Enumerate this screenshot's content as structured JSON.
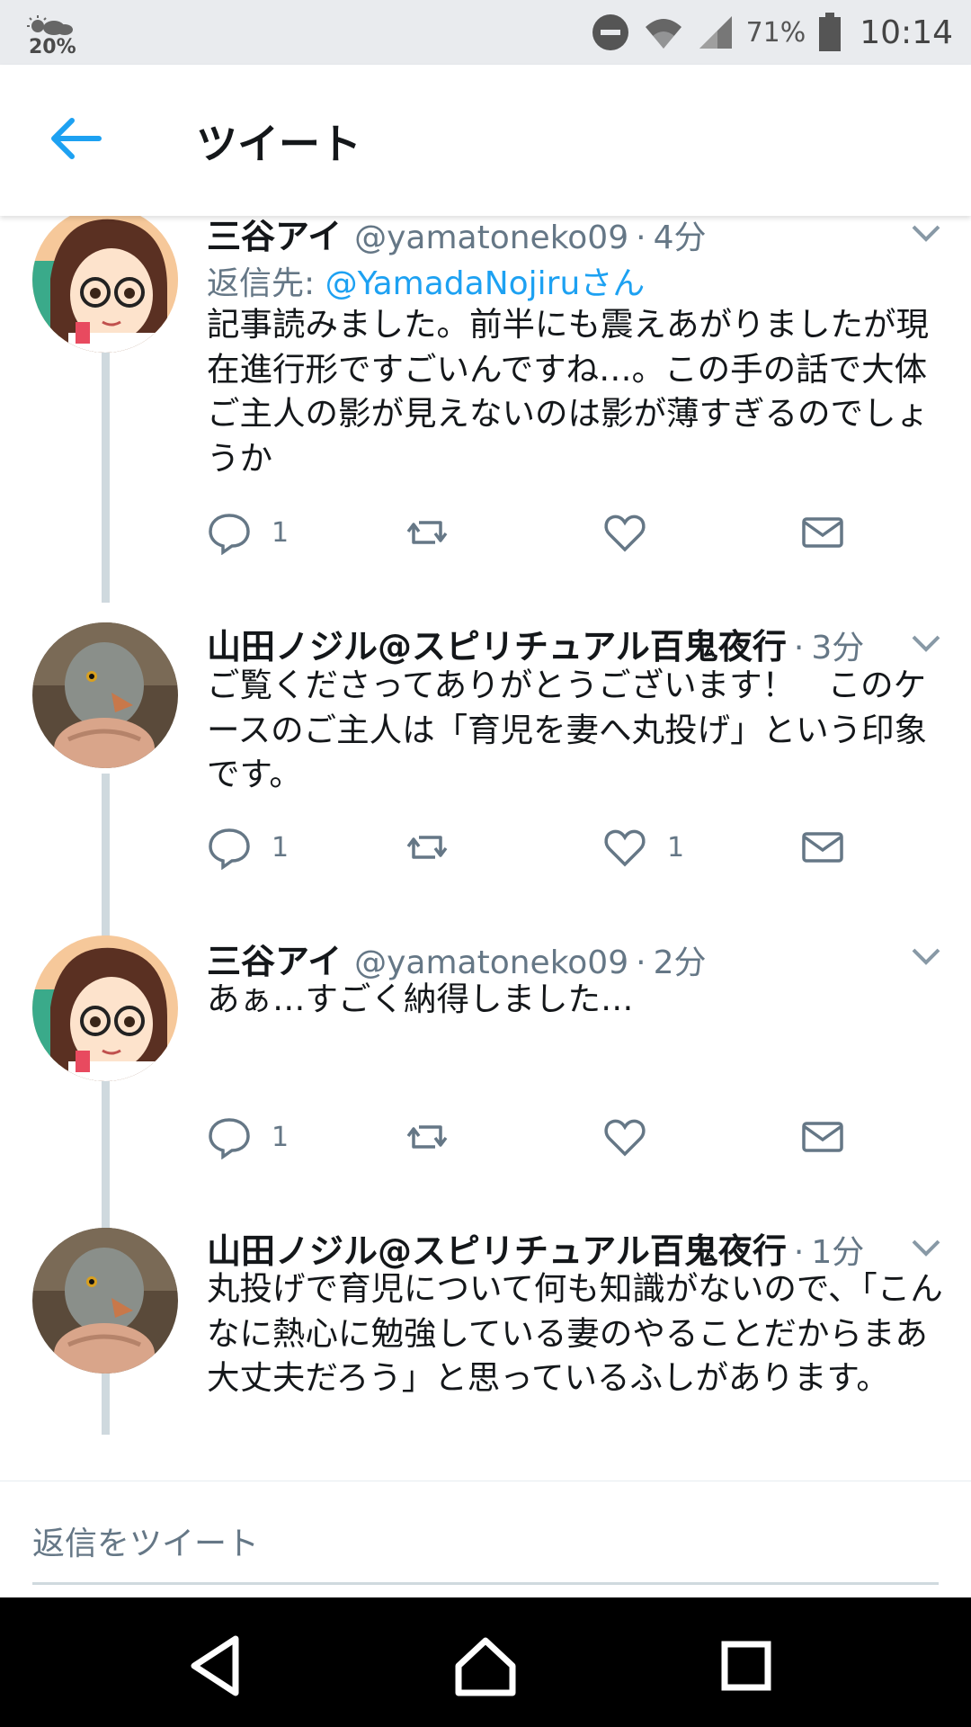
{
  "status_bar": {
    "temp": "20%",
    "battery_pct": "71%",
    "time": "10:14"
  },
  "header": {
    "title": "ツイート"
  },
  "tweets": [
    {
      "name": "三谷アイ",
      "handle": "@yamatoneko09",
      "time": "4分",
      "reply_to_label": "返信先: ",
      "reply_to_link": "@YamadaNojiruさん",
      "text": "記事読みました。前半にも震えあがりましたが現在進行形ですごいんですね…。この手の話で大体ご主人の影が見えないのは影が薄すぎるのでしょうか",
      "reply_count": "1",
      "like_count": ""
    },
    {
      "name": "山田ノジル@スピリチュアル百鬼夜行",
      "handle": "",
      "time": "3分",
      "text": "ご覧くださってありがとうございます！　このケースのご主人は「育児を妻へ丸投げ」という印象です。",
      "reply_count": "1",
      "like_count": "1"
    },
    {
      "name": "三谷アイ",
      "handle": "@yamatoneko09",
      "time": "2分",
      "text": "あぁ…すごく納得しました…",
      "reply_count": "1",
      "like_count": ""
    },
    {
      "name": "山田ノジル@スピリチュアル百鬼夜行",
      "handle": "",
      "time": "1分",
      "text": "丸投げで育児について何も知識がないので、「こんなに熱心に勉強している妻のやることだからまあ大丈夫だろう」と思っているふしがあります。",
      "reply_count": "",
      "like_count": ""
    }
  ],
  "reply_bar": {
    "placeholder": "返信をツイート"
  },
  "colors": {
    "accent": "#1da1f2",
    "muted": "#657786",
    "thread_line": "#cfd9de"
  }
}
